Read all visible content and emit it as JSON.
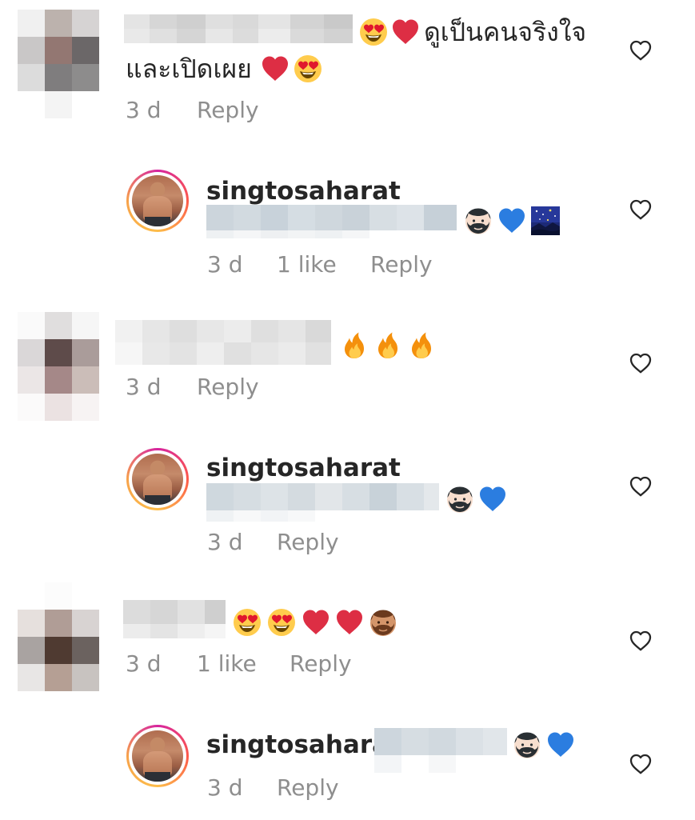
{
  "comments": [
    {
      "text_line1": "ดูเป็นคนจริงใจ",
      "text_line2": "และเปิดเผย",
      "time": "3 d",
      "reply_label": "Reply"
    },
    {
      "username": "singtosaharat",
      "time": "3 d",
      "likes": "1 like",
      "reply_label": "Reply"
    },
    {
      "time": "3 d",
      "reply_label": "Reply"
    },
    {
      "username": "singtosaharat",
      "time": "3 d",
      "reply_label": "Reply"
    },
    {
      "time": "3 d",
      "likes": "1 like",
      "reply_label": "Reply"
    },
    {
      "username": "singtosaharat",
      "time": "3 d",
      "reply_label": "Reply"
    }
  ],
  "icons": {
    "like": "heart-outline-icon"
  },
  "colors": {
    "text": "#262626",
    "meta": "#8e8e8e",
    "heart_red": "#e0182d",
    "heart_blue": "#1d7ce0"
  }
}
